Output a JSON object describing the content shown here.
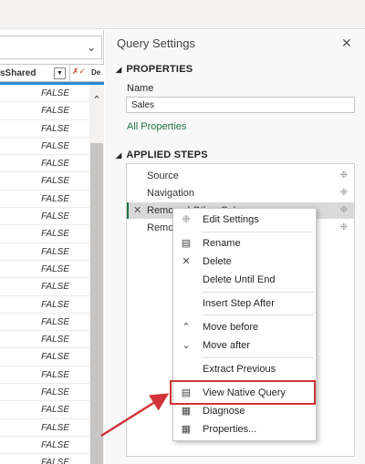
{
  "grid": {
    "column1_header": "sShared",
    "column2_header": "De",
    "values": [
      "FALSE",
      "FALSE",
      "FALSE",
      "FALSE",
      "FALSE",
      "FALSE",
      "FALSE",
      "FALSE",
      "FALSE",
      "FALSE",
      "FALSE",
      "FALSE",
      "FALSE",
      "FALSE",
      "FALSE",
      "FALSE",
      "FALSE",
      "FALSE",
      "FALSE",
      "FALSE",
      "FALSE",
      "FALSE"
    ]
  },
  "query_settings": {
    "title": "Query Settings",
    "properties_heading": "PROPERTIES",
    "name_label": "Name",
    "name_value": "Sales",
    "all_properties_link": "All Properties",
    "applied_steps_heading": "APPLIED STEPS",
    "steps": [
      "Source",
      "Navigation",
      "Removed Other Columns",
      "Remo"
    ]
  },
  "context_menu": {
    "items": {
      "edit_settings": "Edit Settings",
      "rename": "Rename",
      "delete": "Delete",
      "delete_until_end": "Delete Until End",
      "insert_step_after": "Insert Step After",
      "move_before": "Move before",
      "move_after": "Move after",
      "extract_previous": "Extract Previous",
      "view_native_query": "View Native Query",
      "diagnose": "Diagnose",
      "properties": "Properties..."
    }
  },
  "colors": {
    "accent_green": "#217346",
    "highlight_red": "#d13438",
    "selection_blue": "#2b88d8"
  }
}
